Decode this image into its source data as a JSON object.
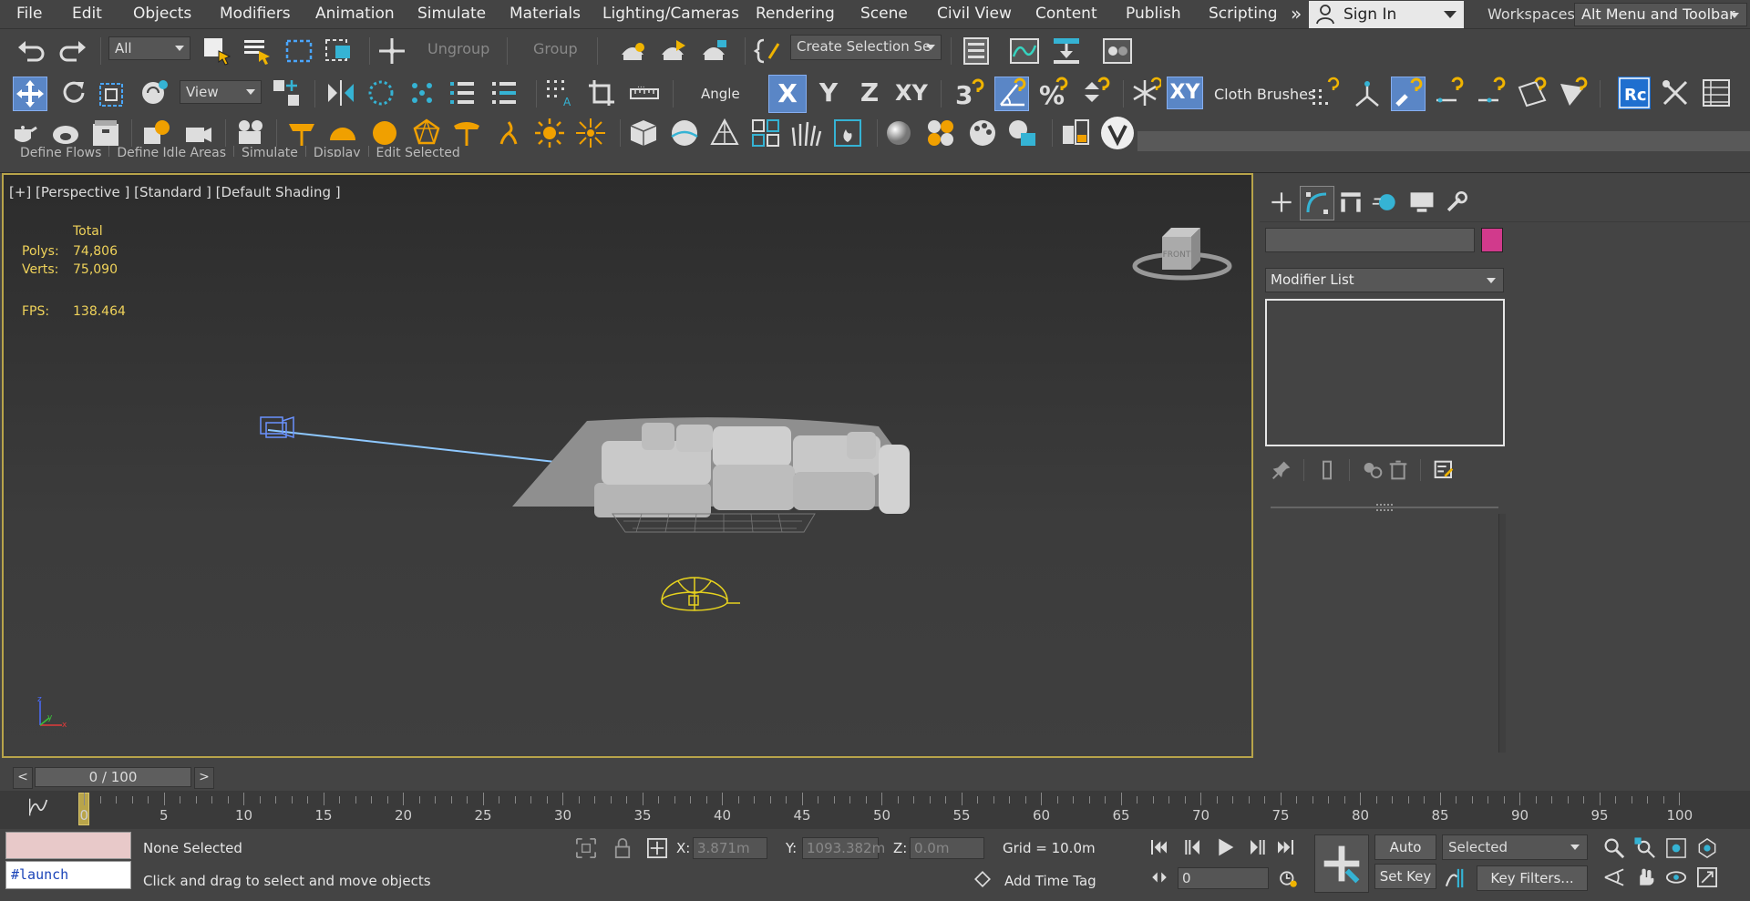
{
  "menu": [
    "File",
    "Edit",
    "Objects",
    "Modifiers",
    "Animation",
    "Simulate",
    "Materials",
    "Lighting/Cameras",
    "Rendering",
    "Scene",
    "Civil View",
    "Content",
    "Publish",
    "Scripting"
  ],
  "menu_overflow": "»",
  "signin": "Sign In",
  "workspaces": {
    "label": "Workspaces:",
    "value": "Alt Menu and Toolbar"
  },
  "toolbar1": {
    "filter": "All",
    "ungroup": "Ungroup",
    "group": "Group",
    "selection_set": "Create Selection Se"
  },
  "toolbar2": {
    "ref_coord": "View",
    "angle": "Angle",
    "axes": [
      "X",
      "Y",
      "Z",
      "XY"
    ],
    "cloth": "Cloth Brushes",
    "xy_snap": "XY"
  },
  "ribbon_hidden_tabs": [
    "Define Flows",
    "Define Idle Areas",
    "Simulate",
    "Display",
    "Edit Selected"
  ],
  "viewport": {
    "label": "[+] [Perspective ] [Standard ] [Default Shading ]",
    "stats": {
      "header": "Total",
      "polys_label": "Polys:",
      "polys": "74,806",
      "verts_label": "Verts:",
      "verts": "75,090",
      "fps_label": "FPS:",
      "fps": "138.464"
    },
    "viewcube_label": "FRONT"
  },
  "command_panel": {
    "object_color": "#d13a8c",
    "modifier_list": "Modifier List"
  },
  "timeline": {
    "slider": "0 / 100",
    "prev": "<",
    "next": ">",
    "ticks": [
      "0",
      "5",
      "10",
      "15",
      "20",
      "25",
      "30",
      "35",
      "40",
      "45",
      "50",
      "55",
      "60",
      "65",
      "70",
      "75",
      "80",
      "85",
      "90",
      "95",
      "100"
    ]
  },
  "status": {
    "maxscript_input": "#launch",
    "selection": "None Selected",
    "prompt": "Click and drag to select and move objects",
    "x_label": "X:",
    "x": "3.871m",
    "y_label": "Y:",
    "y": "1093.382m",
    "z_label": "Z:",
    "z": "0.0m",
    "grid": "Grid = 10.0m",
    "add_time_tag": "Add Time Tag",
    "frame": "0",
    "auto_key": "Auto Key",
    "set_key": "Set Key",
    "key_mode": "Selected",
    "key_filters": "Key Filters..."
  }
}
